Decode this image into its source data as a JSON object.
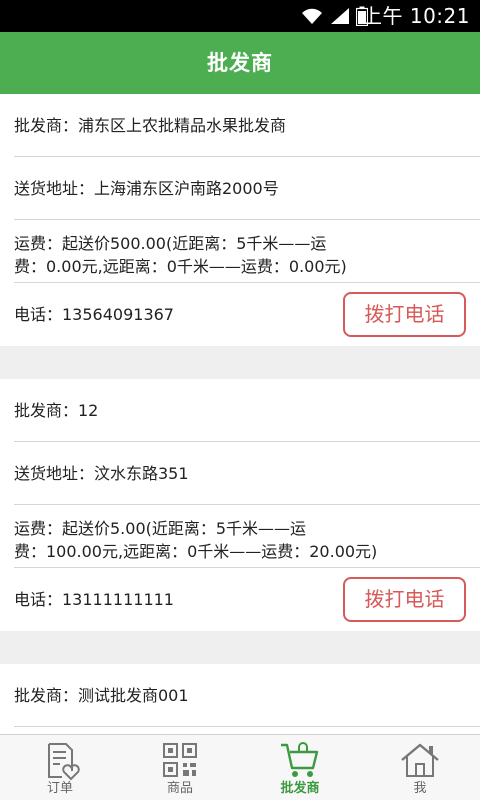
{
  "status_bar": {
    "time": "上午 10:21",
    "icons": [
      "wifi-icon",
      "signal-icon",
      "battery-icon"
    ]
  },
  "header": {
    "title": "批发商"
  },
  "wholesalers": [
    {
      "name": "批发商：浦东区上农批精品水果批发商",
      "address": "送货地址：上海浦东区沪南路2000号",
      "fee_line1": "运费：起送价500.00(近距离：5千米——运",
      "fee_line2": "费：0.00元,远距离：0千米——运费：0.00元)",
      "phone": "电话：13564091367",
      "call_label": "拨打电话"
    },
    {
      "name": "批发商：12",
      "address": "送货地址：汶水东路351",
      "fee_line1": "运费：起送价5.00(近距离：5千米——运",
      "fee_line2": "费：100.00元,远距离：0千米——运费：20.00元)",
      "phone": "电话：13111111111",
      "call_label": "拨打电话"
    },
    {
      "name": "批发商：测试批发商001"
    }
  ],
  "tab_bar": {
    "tabs": [
      {
        "label": "订单",
        "icon": "order-icon",
        "active": false
      },
      {
        "label": "商品",
        "icon": "qr-code-icon",
        "active": false
      },
      {
        "label": "批发商",
        "icon": "shopping-cart-icon",
        "active": true
      },
      {
        "label": "我",
        "icon": "home-icon",
        "active": false
      }
    ]
  },
  "colors": {
    "header_green": "#4cae50",
    "active_tab": "#3c9a40",
    "call_button_red": "#d65a57",
    "background": "#efefef"
  }
}
